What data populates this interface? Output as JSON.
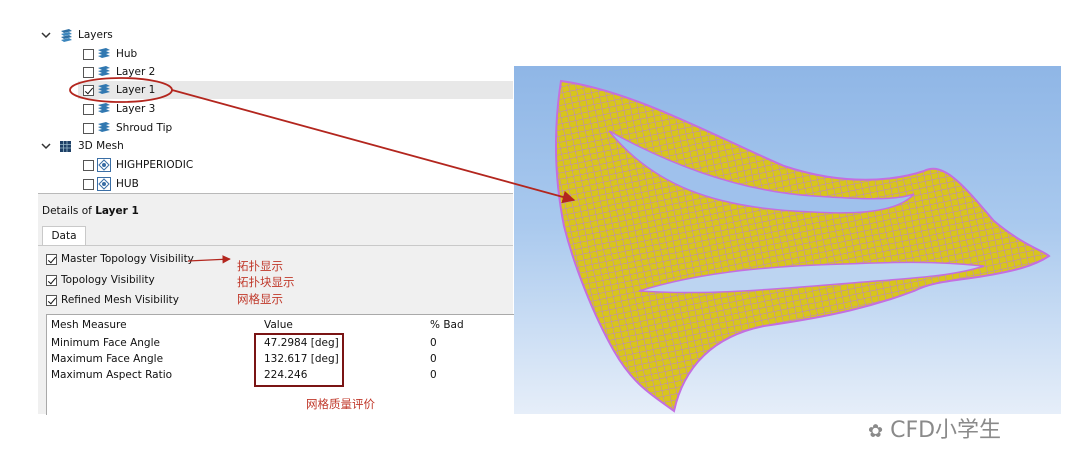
{
  "tree": {
    "layers": {
      "label": "Layers",
      "children": [
        {
          "label": "Hub",
          "checked": false
        },
        {
          "label": "Layer 2",
          "checked": false
        },
        {
          "label": "Layer 1",
          "checked": true,
          "selected": true
        },
        {
          "label": "Layer 3",
          "checked": false
        },
        {
          "label": "Shroud Tip",
          "checked": false
        }
      ]
    },
    "mesh3d": {
      "label": "3D Mesh",
      "children": [
        {
          "label": "HIGHPERIODIC",
          "checked": false
        },
        {
          "label": "HUB",
          "checked": false
        }
      ]
    }
  },
  "details": {
    "title_prefix": "Details of ",
    "title_object": "Layer 1",
    "tab": "Data",
    "options": [
      {
        "label": "Master Topology Visibility",
        "checked": true
      },
      {
        "label": "Topology Visibility",
        "checked": true
      },
      {
        "label": "Refined Mesh Visibility",
        "checked": true
      }
    ],
    "table": {
      "headers": [
        "Mesh Measure",
        "Value",
        "% Bad"
      ],
      "rows": [
        [
          "Minimum Face Angle",
          "47.2984 [deg]",
          "0"
        ],
        [
          "Maximum Face Angle",
          "132.617 [deg]",
          "0"
        ],
        [
          "Maximum Aspect Ratio",
          "224.246",
          "0"
        ]
      ]
    }
  },
  "annotations": {
    "master_topology": "拓扑显示",
    "topology": "拓扑块显示",
    "refined_mesh": "网格显示",
    "mesh_quality": "网格质量评价"
  },
  "watermark": "CFD小学生",
  "colors": {
    "annotation_red": "#c0392b",
    "mesh_yellow": "#d4c21a",
    "mesh_line": "#c57be0",
    "selection_bg": "#e8e8e8"
  }
}
